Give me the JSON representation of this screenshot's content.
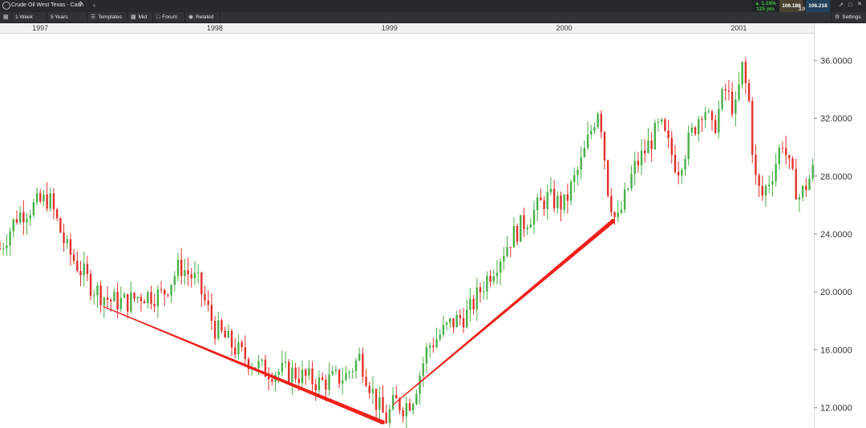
{
  "window": {
    "title": "Crude Oil West Texas - Cash",
    "add_tab": "+"
  },
  "quote": {
    "change_pct": "1.19%",
    "change_pts": "125 pts",
    "sell": "106.188",
    "spread": "3.0",
    "buy": "106.218",
    "up_color": "#3fbf3f"
  },
  "toolbar": {
    "interval": "1 Week",
    "range": "5 Years",
    "templates": "Templates",
    "mid": "Mid",
    "forum": "Forum",
    "related": "Related",
    "settings": "Settings"
  },
  "chart_data": {
    "type": "candlestick",
    "title": "",
    "x_axis": {
      "labels": [
        "1997",
        "1998",
        "1999",
        "2000",
        "2001"
      ],
      "range": [
        1996.77,
        2001.43
      ]
    },
    "y_axis": {
      "ticks": [
        "36.0000",
        "32.0000",
        "28.0000",
        "24.0000",
        "20.0000",
        "16.0000",
        "12.0000"
      ],
      "range": [
        10.6,
        37.9
      ]
    },
    "colors": {
      "up": "#49b049",
      "down": "#e0302b",
      "trendline": "#f0201a"
    },
    "anchor_points": [
      {
        "x": 1996.77,
        "y": 23.0
      },
      {
        "x": 1996.87,
        "y": 25.3
      },
      {
        "x": 1997.05,
        "y": 26.5
      },
      {
        "x": 1997.15,
        "y": 23.0
      },
      {
        "x": 1997.3,
        "y": 20.3
      },
      {
        "x": 1997.4,
        "y": 19.4
      },
      {
        "x": 1997.5,
        "y": 19.3
      },
      {
        "x": 1997.58,
        "y": 19.8
      },
      {
        "x": 1997.7,
        "y": 19.8
      },
      {
        "x": 1997.8,
        "y": 21.8
      },
      {
        "x": 1997.9,
        "y": 20.7
      },
      {
        "x": 1998.0,
        "y": 17.5
      },
      {
        "x": 1998.15,
        "y": 15.7
      },
      {
        "x": 1998.28,
        "y": 14.6
      },
      {
        "x": 1998.45,
        "y": 14.4
      },
      {
        "x": 1998.6,
        "y": 13.7
      },
      {
        "x": 1998.75,
        "y": 14.2
      },
      {
        "x": 1998.83,
        "y": 15.5
      },
      {
        "x": 1998.93,
        "y": 12.2
      },
      {
        "x": 1998.98,
        "y": 11.2
      },
      {
        "x": 1999.03,
        "y": 12.4
      },
      {
        "x": 1999.08,
        "y": 12.1
      },
      {
        "x": 1999.13,
        "y": 12.6
      },
      {
        "x": 1999.22,
        "y": 16.2
      },
      {
        "x": 1999.35,
        "y": 17.8
      },
      {
        "x": 1999.45,
        "y": 18.5
      },
      {
        "x": 1999.55,
        "y": 20.8
      },
      {
        "x": 1999.7,
        "y": 23.8
      },
      {
        "x": 1999.8,
        "y": 25.2
      },
      {
        "x": 1999.9,
        "y": 26.5
      },
      {
        "x": 2000.0,
        "y": 26.0
      },
      {
        "x": 2000.1,
        "y": 29.0
      },
      {
        "x": 2000.2,
        "y": 33.0
      },
      {
        "x": 2000.25,
        "y": 27.2
      },
      {
        "x": 2000.3,
        "y": 24.6
      },
      {
        "x": 2000.4,
        "y": 28.5
      },
      {
        "x": 2000.55,
        "y": 31.5
      },
      {
        "x": 2000.65,
        "y": 28.5
      },
      {
        "x": 2000.8,
        "y": 33.0
      },
      {
        "x": 2000.85,
        "y": 31.0
      },
      {
        "x": 2000.92,
        "y": 34.0
      },
      {
        "x": 2000.98,
        "y": 32.5
      },
      {
        "x": 2001.02,
        "y": 35.5
      },
      {
        "x": 2001.06,
        "y": 33.0
      },
      {
        "x": 2001.09,
        "y": 28.0
      },
      {
        "x": 2001.13,
        "y": 26.5
      },
      {
        "x": 2001.2,
        "y": 28.5
      },
      {
        "x": 2001.25,
        "y": 30.5
      },
      {
        "x": 2001.3,
        "y": 28.0
      },
      {
        "x": 2001.35,
        "y": 26.5
      },
      {
        "x": 2001.43,
        "y": 28.5
      }
    ],
    "trendlines": [
      {
        "from": {
          "x": 1997.36,
          "y": 19.0
        },
        "to": {
          "x": 1998.96,
          "y": 11.0
        },
        "style": "down-thin-to-thick"
      },
      {
        "from": {
          "x": 1999.02,
          "y": 12.2
        },
        "to": {
          "x": 2000.28,
          "y": 24.9
        },
        "style": "up-thin-to-thick"
      }
    ]
  }
}
